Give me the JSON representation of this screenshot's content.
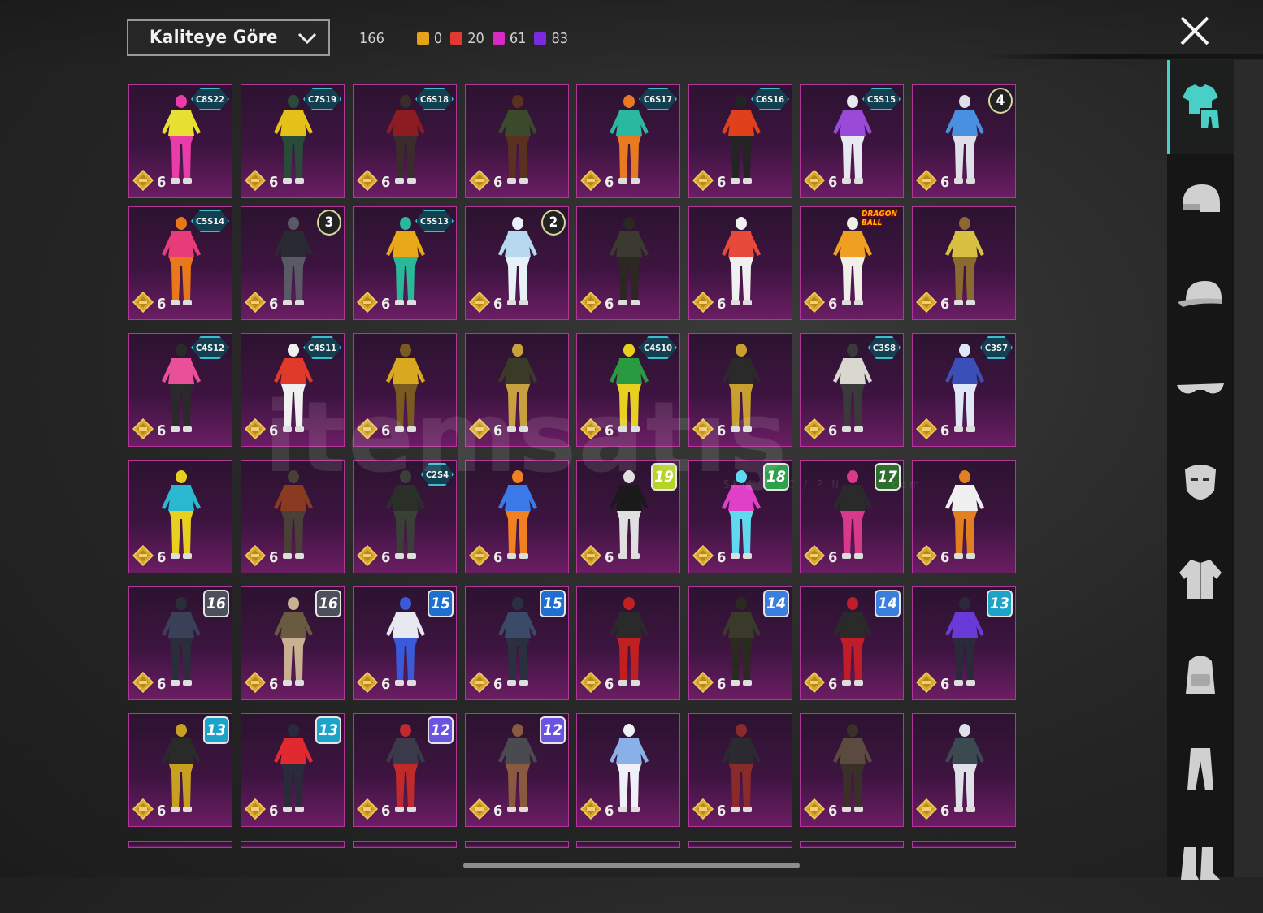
{
  "sort": {
    "label": "Kaliteye Göre"
  },
  "counts": {
    "total": "166",
    "items": [
      {
        "color": "#e8a21a",
        "value": "0"
      },
      {
        "color": "#e23a32",
        "value": "20"
      },
      {
        "color": "#d52bc3",
        "value": "61"
      },
      {
        "color": "#7a2be0",
        "value": "83"
      }
    ]
  },
  "watermark": {
    "text": "itemsatış",
    "sub": "SKIN / UC / PIN",
    "tld": "com"
  },
  "rail": [
    "outfit-icon",
    "helmet-icon",
    "cap-icon",
    "glasses-icon",
    "mask-icon",
    "jacket-icon",
    "backpack-icon",
    "pants-icon",
    "shoes-icon"
  ],
  "level_label": "6",
  "tiles": [
    {
      "badge": "C8S22",
      "btype": "season"
    },
    {
      "badge": "C7S19",
      "btype": "season"
    },
    {
      "badge": "C6S18",
      "btype": "season"
    },
    {
      "badge": "",
      "btype": ""
    },
    {
      "badge": "C6S17",
      "btype": "season"
    },
    {
      "badge": "C6S16",
      "btype": "season"
    },
    {
      "badge": "C5S15",
      "btype": "season"
    },
    {
      "badge": "4",
      "btype": "num"
    },
    {
      "badge": "C5S14",
      "btype": "season"
    },
    {
      "badge": "3",
      "btype": "num"
    },
    {
      "badge": "C5S13",
      "btype": "season"
    },
    {
      "badge": "2",
      "btype": "num"
    },
    {
      "badge": "",
      "btype": ""
    },
    {
      "badge": "",
      "btype": ""
    },
    {
      "badge": "DRAGON BALL",
      "btype": "dbz"
    },
    {
      "badge": "",
      "btype": ""
    },
    {
      "badge": "C4S12",
      "btype": "season"
    },
    {
      "badge": "C4S11",
      "btype": "season"
    },
    {
      "badge": "",
      "btype": ""
    },
    {
      "badge": "",
      "btype": ""
    },
    {
      "badge": "C4S10",
      "btype": "season"
    },
    {
      "badge": "",
      "btype": ""
    },
    {
      "badge": "C3S8",
      "btype": "season"
    },
    {
      "badge": "C3S7",
      "btype": "season"
    },
    {
      "badge": "",
      "btype": ""
    },
    {
      "badge": "",
      "btype": ""
    },
    {
      "badge": "C2S4",
      "btype": "season"
    },
    {
      "badge": "",
      "btype": ""
    },
    {
      "badge": "19",
      "btype": "rp",
      "color": "#b7d426"
    },
    {
      "badge": "18",
      "btype": "rp",
      "color": "#2aa14a"
    },
    {
      "badge": "17",
      "btype": "rp",
      "color": "#2d6e2f"
    },
    {
      "badge": "",
      "btype": ""
    },
    {
      "badge": "16",
      "btype": "rp",
      "color": "#4c4f5c"
    },
    {
      "badge": "16",
      "btype": "rp",
      "color": "#4c4f5c"
    },
    {
      "badge": "15",
      "btype": "rp",
      "color": "#1f6fd0"
    },
    {
      "badge": "15",
      "btype": "rp",
      "color": "#1f6fd0"
    },
    {
      "badge": "",
      "btype": ""
    },
    {
      "badge": "14",
      "btype": "rp",
      "color": "#3a7fe0"
    },
    {
      "badge": "14",
      "btype": "rp",
      "color": "#3a7fe0"
    },
    {
      "badge": "13",
      "btype": "rp",
      "color": "#1ea3c8"
    },
    {
      "badge": "13",
      "btype": "rp",
      "color": "#1ea3c8"
    },
    {
      "badge": "13",
      "btype": "rp",
      "color": "#1ea3c8"
    },
    {
      "badge": "12",
      "btype": "rp",
      "color": "#6a55e0"
    },
    {
      "badge": "12",
      "btype": "rp",
      "color": "#6a55e0"
    },
    {
      "badge": "",
      "btype": ""
    },
    {
      "badge": "",
      "btype": ""
    },
    {
      "badge": "",
      "btype": ""
    },
    {
      "badge": "",
      "btype": ""
    }
  ],
  "outfit_colors": [
    [
      "#e8e030",
      "#e83ca8"
    ],
    [
      "#e4c21a",
      "#2a4a3a"
    ],
    [
      "#8a1c22",
      "#3a2c2c"
    ],
    [
      "#3a4a2a",
      "#5a3020"
    ],
    [
      "#2ab8a0",
      "#e87a20"
    ],
    [
      "#e0401c",
      "#242424"
    ],
    [
      "#9a4ad8",
      "#e8e8f0"
    ],
    [
      "#4a90e0",
      "#e0e0e8"
    ],
    [
      "#e83c7a",
      "#e8781a"
    ],
    [
      "#2a2a32",
      "#5a5a66"
    ],
    [
      "#e8a818",
      "#2ab89a"
    ],
    [
      "#b8d8f0",
      "#e8f0f8"
    ],
    [
      "#3a3a30",
      "#2a2820"
    ],
    [
      "#e84a3a",
      "#f0f0f0"
    ],
    [
      "#f0a020",
      "#f0f0e8"
    ],
    [
      "#d8c040",
      "#8a6a30"
    ],
    [
      "#e8509a",
      "#2a2a2a"
    ],
    [
      "#e03a2a",
      "#f0f0f0"
    ],
    [
      "#d8a820",
      "#7a5a20"
    ],
    [
      "#3a3a28",
      "#c8a040"
    ],
    [
      "#2a9a40",
      "#e8d020"
    ],
    [
      "#2a2a2a",
      "#c8a030"
    ],
    [
      "#d8d8d0",
      "#3a3a3a"
    ],
    [
      "#3a50b8",
      "#e0e8f8"
    ],
    [
      "#2ab8d0",
      "#e8d020"
    ],
    [
      "#8a3a20",
      "#4a4038"
    ],
    [
      "#2a3028",
      "#3a4038"
    ],
    [
      "#3a7ae8",
      "#f08020"
    ],
    [
      "#1a1a1a",
      "#e0e0e0"
    ],
    [
      "#e040c8",
      "#60d8f0"
    ],
    [
      "#2a2a2a",
      "#d83a8a"
    ],
    [
      "#f0f0f0",
      "#e08020"
    ],
    [
      "#3a4058",
      "#2a2e3a"
    ],
    [
      "#6a5a40",
      "#c8b090"
    ],
    [
      "#e8e8f0",
      "#3a5ad8"
    ],
    [
      "#3a4a68",
      "#2a3040"
    ],
    [
      "#2a2a2a",
      "#c02020"
    ],
    [
      "#3a3a2a",
      "#2a2a20"
    ],
    [
      "#2a2a2a",
      "#c01c2a"
    ],
    [
      "#6a3ad8",
      "#2a2a3a"
    ],
    [
      "#2a2a2a",
      "#c8a020"
    ],
    [
      "#e02a30",
      "#2a2a3a"
    ],
    [
      "#3a3a4a",
      "#c02a2a"
    ],
    [
      "#4a4a50",
      "#8a5a40"
    ],
    [
      "#8ab0e8",
      "#f0f0f8"
    ],
    [
      "#2a2a30",
      "#8a2a2a"
    ],
    [
      "#5a4a40",
      "#3a3028"
    ],
    [
      "#3a4a50",
      "#e0e0e8"
    ]
  ]
}
